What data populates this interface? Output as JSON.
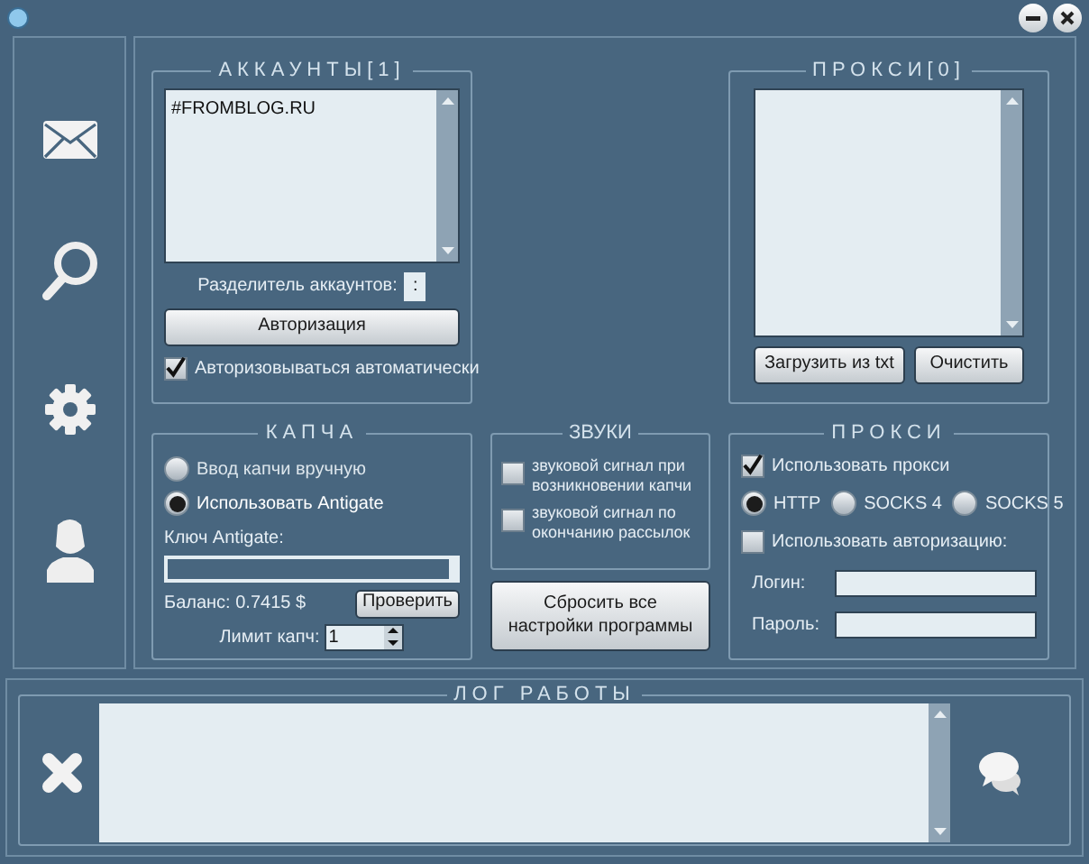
{
  "accounts": {
    "title": "АККАУНТЫ[1]",
    "list_items": [
      "#FROMBLOG.RU"
    ],
    "separator_label": "Разделитель аккаунтов:",
    "separator_value": ":",
    "auth_button": "Авторизация",
    "auto_auth": {
      "label": "Авторизовываться автоматически",
      "checked": true
    }
  },
  "proxy_list": {
    "title": "ПРОКСИ[0]",
    "buttons": [
      "Загрузить из txt",
      "Очистить"
    ]
  },
  "captcha": {
    "title": "КАПЧА",
    "options": [
      {
        "label": "Ввод капчи вручную",
        "selected": false
      },
      {
        "label": "Использовать Antigate",
        "selected": true
      }
    ],
    "key_label": "Ключ Antigate:",
    "balance": "Баланс: 0.7415 $",
    "check_button": "Проверить",
    "limit_label": "Лимит капч:",
    "limit_value": "1"
  },
  "sounds": {
    "title": "ЗВУКИ",
    "options": [
      {
        "label": "звуковой сигнал при возникновении капчи",
        "checked": false
      },
      {
        "label": "звуковой сигнал по окончанию рассылок",
        "checked": false
      }
    ]
  },
  "reset_button": "Сбросить все настройки программы",
  "proxy_settings": {
    "title": "ПРОКСИ",
    "use_proxy": {
      "label": "Использовать прокси",
      "checked": true
    },
    "types": [
      {
        "label": "HTTP",
        "selected": true
      },
      {
        "label": "SOCKS 4",
        "selected": false
      },
      {
        "label": "SOCKS 5",
        "selected": false
      }
    ],
    "use_auth": {
      "label": "Использовать авторизацию:",
      "checked": false
    },
    "fields": [
      {
        "label": "Логин:"
      },
      {
        "label": "Пароль:"
      }
    ]
  },
  "log": {
    "title": "ЛОГ РАБОТЫ"
  }
}
